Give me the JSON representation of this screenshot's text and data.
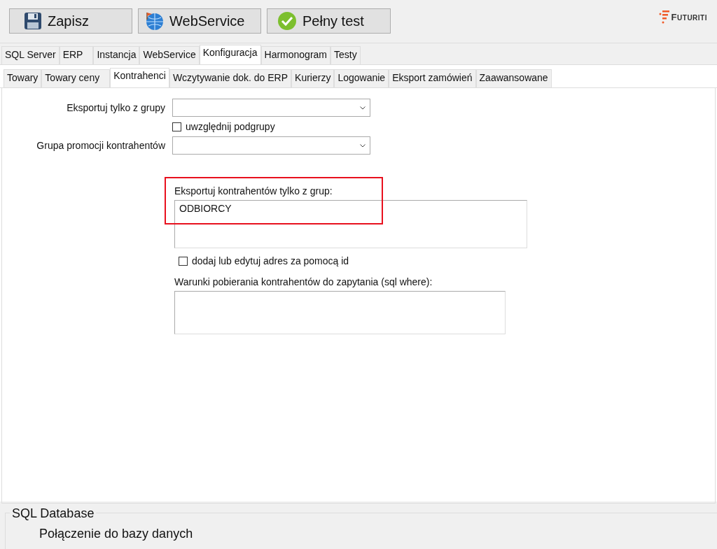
{
  "toolbar": {
    "buttons": [
      {
        "label": "Zapisz",
        "kind": "save"
      },
      {
        "label": "WebService",
        "kind": "web"
      },
      {
        "label": "Pełny test",
        "kind": "test"
      }
    ],
    "logo": "FUTURITI"
  },
  "tabs": [
    {
      "label": "SQL Server",
      "selected": false
    },
    {
      "label": "ERP",
      "selected": false
    },
    {
      "label": "Instancja",
      "selected": false
    },
    {
      "label": "WebService",
      "selected": false
    },
    {
      "label": "Konfiguracja",
      "selected": true
    },
    {
      "label": "Harmonogram",
      "selected": false
    },
    {
      "label": "Testy",
      "selected": false
    }
  ],
  "subtabs": [
    {
      "label": "Towary",
      "selected": false
    },
    {
      "label": "Towary ceny",
      "selected": false
    },
    {
      "label": "Kontrahenci",
      "selected": true
    },
    {
      "label": "Wczytywanie dok. do ERP",
      "selected": false
    },
    {
      "label": "Kurierzy",
      "selected": false
    },
    {
      "label": "Logowanie",
      "selected": false
    },
    {
      "label": "Eksport zamówień",
      "selected": false
    },
    {
      "label": "Zaawansowane",
      "selected": false
    }
  ],
  "form": {
    "export_group": {
      "label": "Eksportuj tylko z grupy"
    },
    "include_subgroups": {
      "label": "uwzględnij podgrupy",
      "checked": false
    },
    "promo_group": {
      "label": "Grupa promocji kontrahentów"
    },
    "export_groups_list": {
      "label": "Eksportuj kontrahentów tylko z grup:",
      "value": "ODBIORCY",
      "highlighted": true
    },
    "edit_address": {
      "label": "dodaj lub edytuj adres za pomocą id",
      "checked": false
    },
    "where_conditions": {
      "label": "Warunki pobierania kontrahentów do zapytania (sql where):"
    }
  },
  "status_group": {
    "title": "SQL Database",
    "text": "Połączenie do bazy danych"
  }
}
